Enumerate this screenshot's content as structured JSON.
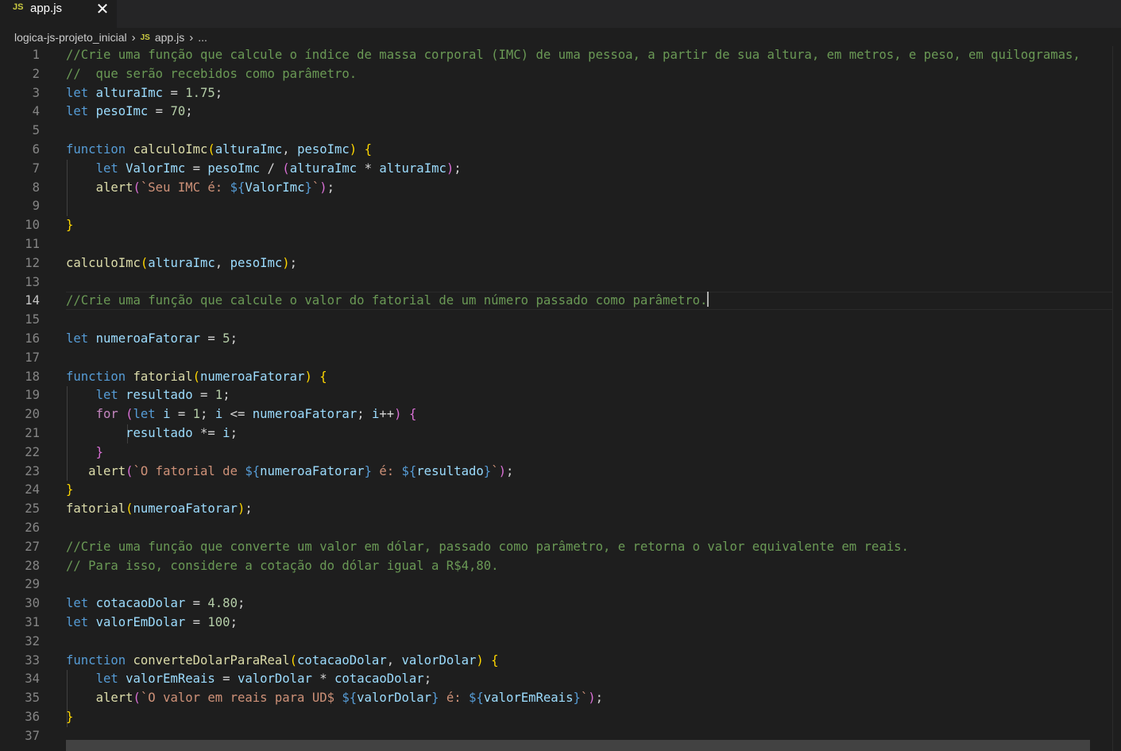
{
  "tab": {
    "label": "app.js",
    "icon": "JS",
    "close": "✕"
  },
  "breadcrumb": {
    "folder": "logica-js-projeto_inicial",
    "file_icon": "JS",
    "file": "app.js",
    "more": "..."
  },
  "active_line": 14,
  "colors": {
    "background": "#1e1e1e",
    "comment": "#6a9955",
    "keyword": "#569cd6",
    "function": "#dcdcaa",
    "variable": "#9cdcfe",
    "number": "#b5cea8",
    "string": "#ce9178"
  },
  "lines": [
    [
      [
        "c",
        "//Crie uma função que calcule o índice de massa corporal (IMC) de uma pessoa, a partir de sua altura, em metros, e peso, em quilogramas,"
      ]
    ],
    [
      [
        "c",
        "//  que serão recebidos como parâmetro."
      ]
    ],
    [
      [
        "k",
        "let"
      ],
      [
        "p",
        " "
      ],
      [
        "v",
        "alturaImc"
      ],
      [
        "p",
        " = "
      ],
      [
        "n",
        "1.75"
      ],
      [
        "p",
        ";"
      ]
    ],
    [
      [
        "k",
        "let"
      ],
      [
        "p",
        " "
      ],
      [
        "v",
        "pesoImc"
      ],
      [
        "p",
        " = "
      ],
      [
        "n",
        "70"
      ],
      [
        "p",
        ";"
      ]
    ],
    [],
    [
      [
        "k",
        "function"
      ],
      [
        "p",
        " "
      ],
      [
        "f",
        "calculoImc"
      ],
      [
        "b1",
        "("
      ],
      [
        "v",
        "alturaImc"
      ],
      [
        "p",
        ", "
      ],
      [
        "v",
        "pesoImc"
      ],
      [
        "b1",
        ")"
      ],
      [
        "p",
        " "
      ],
      [
        "b1",
        "{"
      ]
    ],
    [
      [
        "p",
        "    "
      ],
      [
        "k",
        "let"
      ],
      [
        "p",
        " "
      ],
      [
        "v",
        "ValorImc"
      ],
      [
        "p",
        " = "
      ],
      [
        "v",
        "pesoImc"
      ],
      [
        "p",
        " / "
      ],
      [
        "b2",
        "("
      ],
      [
        "v",
        "alturaImc"
      ],
      [
        "p",
        " * "
      ],
      [
        "v",
        "alturaImc"
      ],
      [
        "b2",
        ")"
      ],
      [
        "p",
        ";"
      ]
    ],
    [
      [
        "p",
        "    "
      ],
      [
        "f",
        "alert"
      ],
      [
        "b2",
        "("
      ],
      [
        "s",
        "`Seu IMC é: "
      ],
      [
        "t",
        "${"
      ],
      [
        "v",
        "ValorImc"
      ],
      [
        "t",
        "}"
      ],
      [
        "s",
        "`"
      ],
      [
        "b2",
        ")"
      ],
      [
        "p",
        ";"
      ]
    ],
    [],
    [
      [
        "b1",
        "}"
      ]
    ],
    [],
    [
      [
        "f",
        "calculoImc"
      ],
      [
        "b1",
        "("
      ],
      [
        "v",
        "alturaImc"
      ],
      [
        "p",
        ", "
      ],
      [
        "v",
        "pesoImc"
      ],
      [
        "b1",
        ")"
      ],
      [
        "p",
        ";"
      ]
    ],
    [],
    [
      [
        "c",
        "//Crie uma função que calcule o valor do fatorial de um número passado como parâmetro."
      ]
    ],
    [],
    [
      [
        "k",
        "let"
      ],
      [
        "p",
        " "
      ],
      [
        "v",
        "numeroaFatorar"
      ],
      [
        "p",
        " = "
      ],
      [
        "n",
        "5"
      ],
      [
        "p",
        ";"
      ]
    ],
    [],
    [
      [
        "k",
        "function"
      ],
      [
        "p",
        " "
      ],
      [
        "f",
        "fatorial"
      ],
      [
        "b1",
        "("
      ],
      [
        "v",
        "numeroaFatorar"
      ],
      [
        "b1",
        ")"
      ],
      [
        "p",
        " "
      ],
      [
        "b1",
        "{"
      ]
    ],
    [
      [
        "p",
        "    "
      ],
      [
        "k",
        "let"
      ],
      [
        "p",
        " "
      ],
      [
        "v",
        "resultado"
      ],
      [
        "p",
        " = "
      ],
      [
        "n",
        "1"
      ],
      [
        "p",
        ";"
      ]
    ],
    [
      [
        "p",
        "    "
      ],
      [
        "ck",
        "for"
      ],
      [
        "p",
        " "
      ],
      [
        "b2",
        "("
      ],
      [
        "k",
        "let"
      ],
      [
        "p",
        " "
      ],
      [
        "v",
        "i"
      ],
      [
        "p",
        " = "
      ],
      [
        "n",
        "1"
      ],
      [
        "p",
        "; "
      ],
      [
        "v",
        "i"
      ],
      [
        "p",
        " <= "
      ],
      [
        "v",
        "numeroaFatorar"
      ],
      [
        "p",
        "; "
      ],
      [
        "v",
        "i"
      ],
      [
        "p",
        "++"
      ],
      [
        "b2",
        ")"
      ],
      [
        "p",
        " "
      ],
      [
        "b2",
        "{"
      ]
    ],
    [
      [
        "p",
        "        "
      ],
      [
        "v",
        "resultado"
      ],
      [
        "p",
        " *= "
      ],
      [
        "v",
        "i"
      ],
      [
        "p",
        ";"
      ]
    ],
    [
      [
        "p",
        "    "
      ],
      [
        "b2",
        "}"
      ]
    ],
    [
      [
        "p",
        "   "
      ],
      [
        "f",
        "alert"
      ],
      [
        "b2",
        "("
      ],
      [
        "s",
        "`O fatorial de "
      ],
      [
        "t",
        "${"
      ],
      [
        "v",
        "numeroaFatorar"
      ],
      [
        "t",
        "}"
      ],
      [
        "s",
        " é: "
      ],
      [
        "t",
        "${"
      ],
      [
        "v",
        "resultado"
      ],
      [
        "t",
        "}"
      ],
      [
        "s",
        "`"
      ],
      [
        "b2",
        ")"
      ],
      [
        "p",
        ";"
      ]
    ],
    [
      [
        "b1",
        "}"
      ]
    ],
    [
      [
        "f",
        "fatorial"
      ],
      [
        "b1",
        "("
      ],
      [
        "v",
        "numeroaFatorar"
      ],
      [
        "b1",
        ")"
      ],
      [
        "p",
        ";"
      ]
    ],
    [],
    [
      [
        "c",
        "//Crie uma função que converte um valor em dólar, passado como parâmetro, e retorna o valor equivalente em reais."
      ]
    ],
    [
      [
        "c",
        "// Para isso, considere a cotação do dólar igual a R$4,80."
      ]
    ],
    [],
    [
      [
        "k",
        "let"
      ],
      [
        "p",
        " "
      ],
      [
        "v",
        "cotacaoDolar"
      ],
      [
        "p",
        " = "
      ],
      [
        "n",
        "4.80"
      ],
      [
        "p",
        ";"
      ]
    ],
    [
      [
        "k",
        "let"
      ],
      [
        "p",
        " "
      ],
      [
        "v",
        "valorEmDolar"
      ],
      [
        "p",
        " = "
      ],
      [
        "n",
        "100"
      ],
      [
        "p",
        ";"
      ]
    ],
    [],
    [
      [
        "k",
        "function"
      ],
      [
        "p",
        " "
      ],
      [
        "f",
        "converteDolarParaReal"
      ],
      [
        "b1",
        "("
      ],
      [
        "v",
        "cotacaoDolar"
      ],
      [
        "p",
        ", "
      ],
      [
        "v",
        "valorDolar"
      ],
      [
        "b1",
        ")"
      ],
      [
        "p",
        " "
      ],
      [
        "b1",
        "{"
      ]
    ],
    [
      [
        "p",
        "    "
      ],
      [
        "k",
        "let"
      ],
      [
        "p",
        " "
      ],
      [
        "v",
        "valorEmReais"
      ],
      [
        "p",
        " = "
      ],
      [
        "v",
        "valorDolar"
      ],
      [
        "p",
        " * "
      ],
      [
        "v",
        "cotacaoDolar"
      ],
      [
        "p",
        ";"
      ]
    ],
    [
      [
        "p",
        "    "
      ],
      [
        "f",
        "alert"
      ],
      [
        "b2",
        "("
      ],
      [
        "s",
        "`O valor em reais para UD$ "
      ],
      [
        "t",
        "${"
      ],
      [
        "v",
        "valorDolar"
      ],
      [
        "t",
        "}"
      ],
      [
        "s",
        " é: "
      ],
      [
        "t",
        "${"
      ],
      [
        "v",
        "valorEmReais"
      ],
      [
        "t",
        "}"
      ],
      [
        "s",
        "`"
      ],
      [
        "b2",
        ")"
      ],
      [
        "p",
        ";"
      ]
    ],
    [
      [
        "b1",
        "}"
      ]
    ],
    []
  ]
}
